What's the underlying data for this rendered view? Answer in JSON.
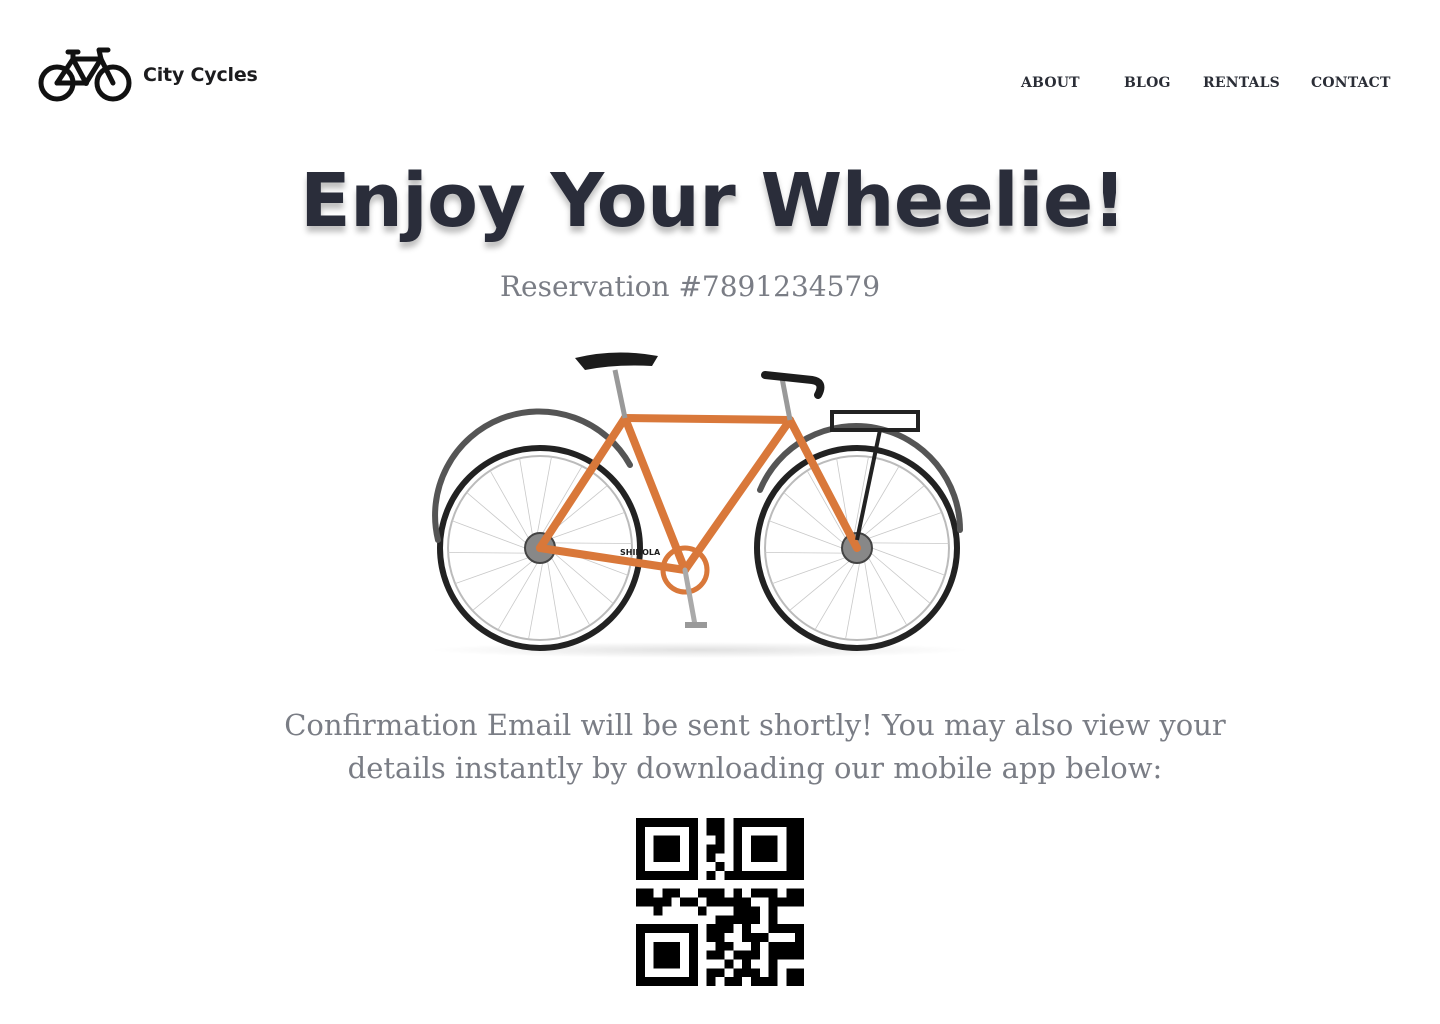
{
  "brand": {
    "name": "City Cycles",
    "logo_icon": "bicycle-icon"
  },
  "nav": {
    "items": [
      "ABOUT",
      "BLOG",
      "RENTALS",
      "CONTACT"
    ]
  },
  "hero": {
    "title": "Enjoy Your Wheelie!",
    "reservation": "Reservation #7891234579",
    "image": "orange-bicycle-image"
  },
  "confirmation": {
    "line1": "Confirmation Email will be sent shortly! You may also view your",
    "line2": "details instantly by downloading our mobile app below:"
  },
  "app_download": {
    "icon": "qr-code-icon"
  },
  "colors": {
    "title": "#2a2d3a",
    "muted_text": "#7a7d85",
    "bike_frame": "#d9783a",
    "background": "#ffffff"
  }
}
